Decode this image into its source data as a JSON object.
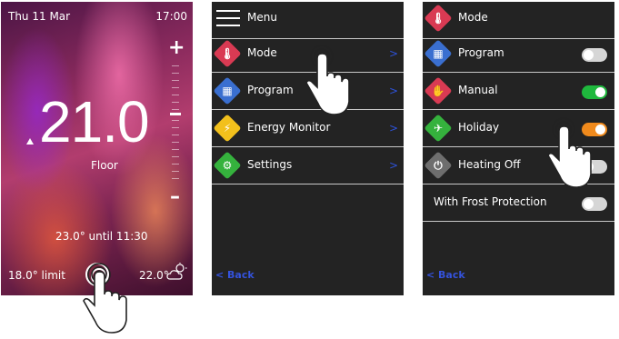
{
  "home": {
    "date": "Thu 11 Mar",
    "time": "17:00",
    "temperature": "21.0",
    "sensor": "Floor",
    "override": "23.0° until 11:30",
    "limit": "18.0° limit",
    "outdoor": "22.0°",
    "plus": "+",
    "minus": "–"
  },
  "menu": {
    "title": "Menu",
    "items": [
      {
        "label": "Mode",
        "icon": "thermometer-icon",
        "color": "#d93a53",
        "glyph": "🌡"
      },
      {
        "label": "Program",
        "icon": "calendar-icon",
        "color": "#3a6fd0",
        "glyph": "▦"
      },
      {
        "label": "Energy Monitor",
        "icon": "lightning-icon",
        "color": "#f2c01c",
        "glyph": "⚡"
      },
      {
        "label": "Settings",
        "icon": "gear-icon",
        "color": "#35b23d",
        "glyph": "⚙"
      }
    ],
    "back": "< Back"
  },
  "mode": {
    "title": "Mode",
    "title_icon": "thermometer-icon",
    "items": [
      {
        "label": "Program",
        "icon": "calendar-icon",
        "color": "#3a6fd0",
        "glyph": "▦",
        "toggle": false
      },
      {
        "label": "Manual",
        "icon": "hand-icon",
        "color": "#d93a53",
        "glyph": "✋",
        "toggle": true
      },
      {
        "label": "Holiday",
        "icon": "airplane-icon",
        "color": "#35b23d",
        "glyph": "✈",
        "toggle": true
      },
      {
        "label": "Heating Off",
        "icon": "power-icon",
        "color": "#6e6e6e",
        "glyph": "⏻",
        "toggle": false
      },
      {
        "label": "With Frost Protection",
        "toggle": false
      }
    ],
    "back": "< Back"
  },
  "colors": {
    "accent_blue": "#2e52d8",
    "toggle_green": "#1fb83d",
    "toggle_orange": "#f08a1c",
    "panel_bg": "#232323"
  }
}
